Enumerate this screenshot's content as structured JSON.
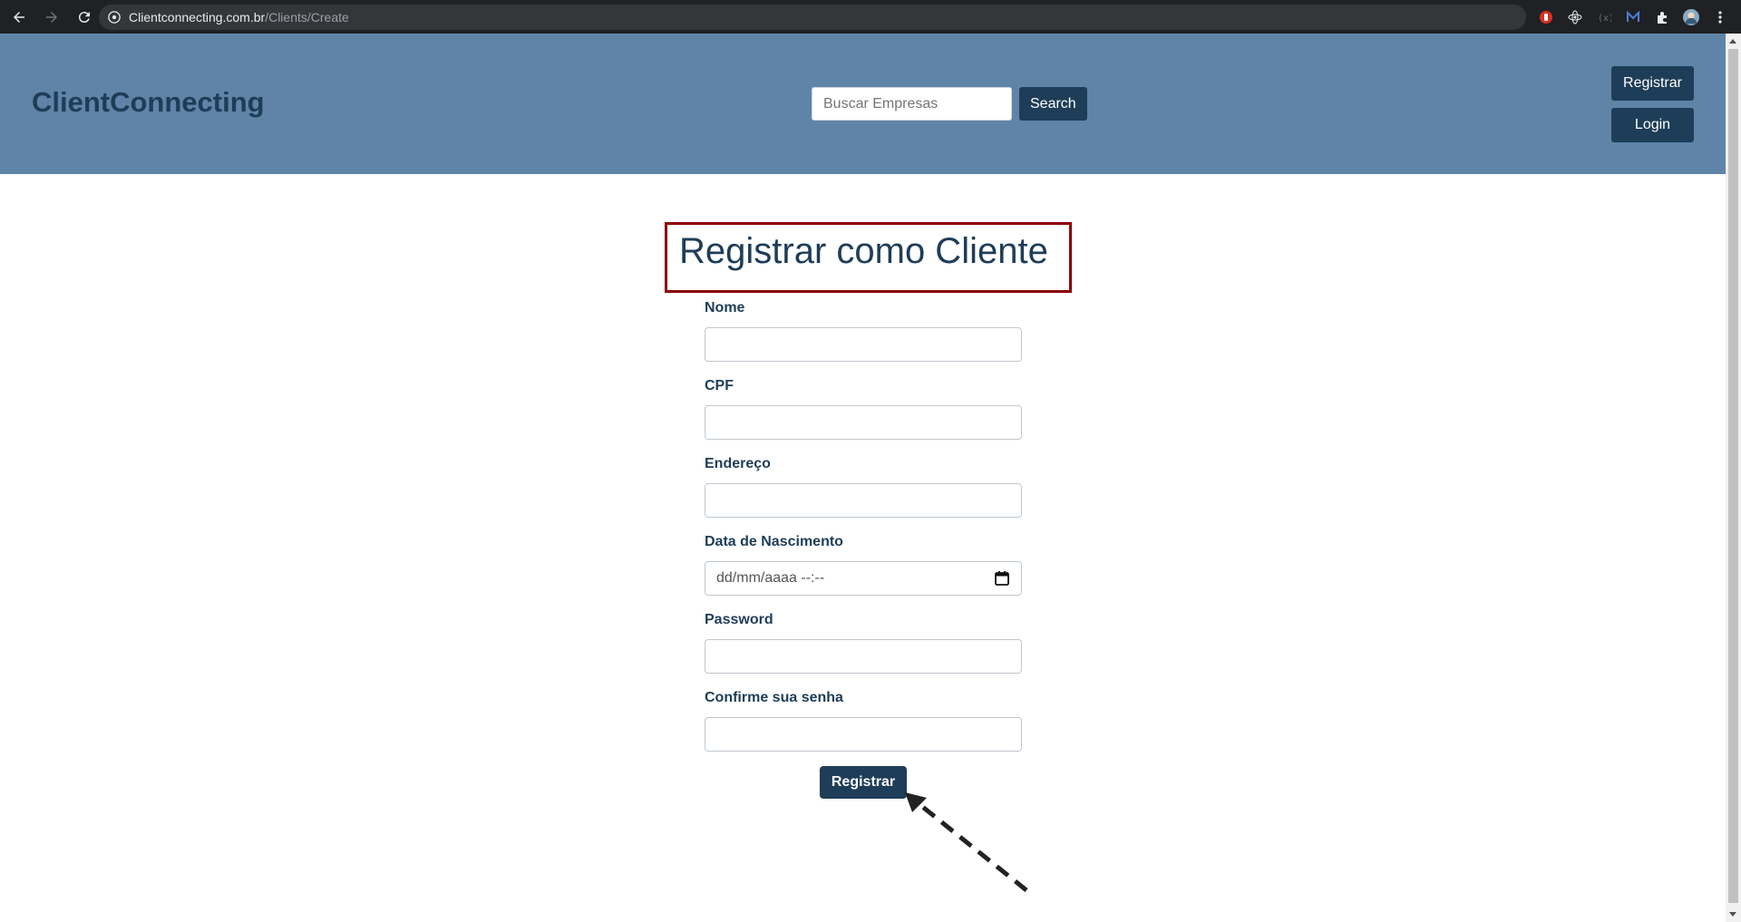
{
  "browser": {
    "url_host": "Clientconnecting.com.br",
    "url_path": "/Clients/Create"
  },
  "header": {
    "brand": "ClientConnecting",
    "search_placeholder": "Buscar Empresas",
    "search_button": "Search",
    "register_button": "Registrar",
    "login_button": "Login"
  },
  "form": {
    "title": "Registrar como Cliente",
    "fields": [
      {
        "label": "Nome",
        "value": ""
      },
      {
        "label": "CPF",
        "value": ""
      },
      {
        "label": "Endereço",
        "value": ""
      },
      {
        "label": "Data de Nascimento",
        "value": "dd/mm/aaaa --:--"
      },
      {
        "label": "Password",
        "value": ""
      },
      {
        "label": "Confirme sua senha",
        "value": ""
      }
    ],
    "submit_label": "Registrar"
  },
  "colors": {
    "header_bg": "#5f84a8",
    "brand_dark": "#1e3d58",
    "highlight_box": "#8b0000"
  }
}
